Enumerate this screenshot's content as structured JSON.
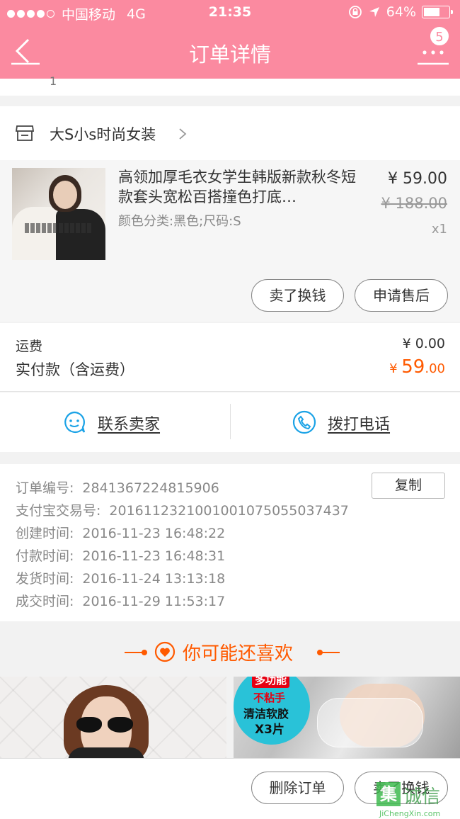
{
  "status_bar": {
    "carrier": "中国移动",
    "network": "4G",
    "time": "21:35",
    "battery": "64%",
    "battery_level": 0.64
  },
  "header": {
    "title": "订单详情",
    "badge_count": "5"
  },
  "top_strip_text": "1",
  "store": {
    "name": "大S小s时尚女装"
  },
  "product": {
    "title": "高领加厚毛衣女学生韩版新款秋冬短款套头宽松百搭撞色打底…",
    "spec": "颜色分类:黑色;尺码:S",
    "price": "¥ 59.00",
    "original_price": "¥ 188.00",
    "quantity": "x1"
  },
  "item_actions": {
    "sell": "卖了换钱",
    "after_sale": "申请售后"
  },
  "fees": {
    "shipping_label": "运费",
    "shipping_value": "¥ 0.00",
    "paid_label": "实付款（含运费）",
    "paid_currency": "¥ ",
    "paid_int": "59",
    "paid_dec": ".00"
  },
  "contact": {
    "seller": "联系卖家",
    "phone": "拨打电话"
  },
  "order_info": {
    "copy_button": "复制",
    "rows": [
      {
        "key": "订单编号:",
        "value": "2841367224815906"
      },
      {
        "key": "支付宝交易号:",
        "value": "2016112321001001075055037437"
      },
      {
        "key": "创建时间:",
        "value": "2016-11-23 16:48:22"
      },
      {
        "key": "付款时间:",
        "value": "2016-11-23 16:48:31"
      },
      {
        "key": "发货时间:",
        "value": "2016-11-24 13:13:18"
      },
      {
        "key": "成交时间:",
        "value": "2016-11-29 11:53:17"
      }
    ]
  },
  "recommend": {
    "title": "你可能还喜欢",
    "item2_tag1": "多功能",
    "item2_tag2": "不粘手",
    "item2_tag3": "清洁软胶",
    "item2_tag4": "X3片"
  },
  "bottom_actions": {
    "delete": "删除订单",
    "sell": "卖了换钱"
  },
  "watermark": {
    "cn": "诚信",
    "en": "JiChengXin.com"
  },
  "colors": {
    "header": "#fb8aa0",
    "accent": "#ff5a00",
    "link_icon": "#1aa2e6"
  }
}
